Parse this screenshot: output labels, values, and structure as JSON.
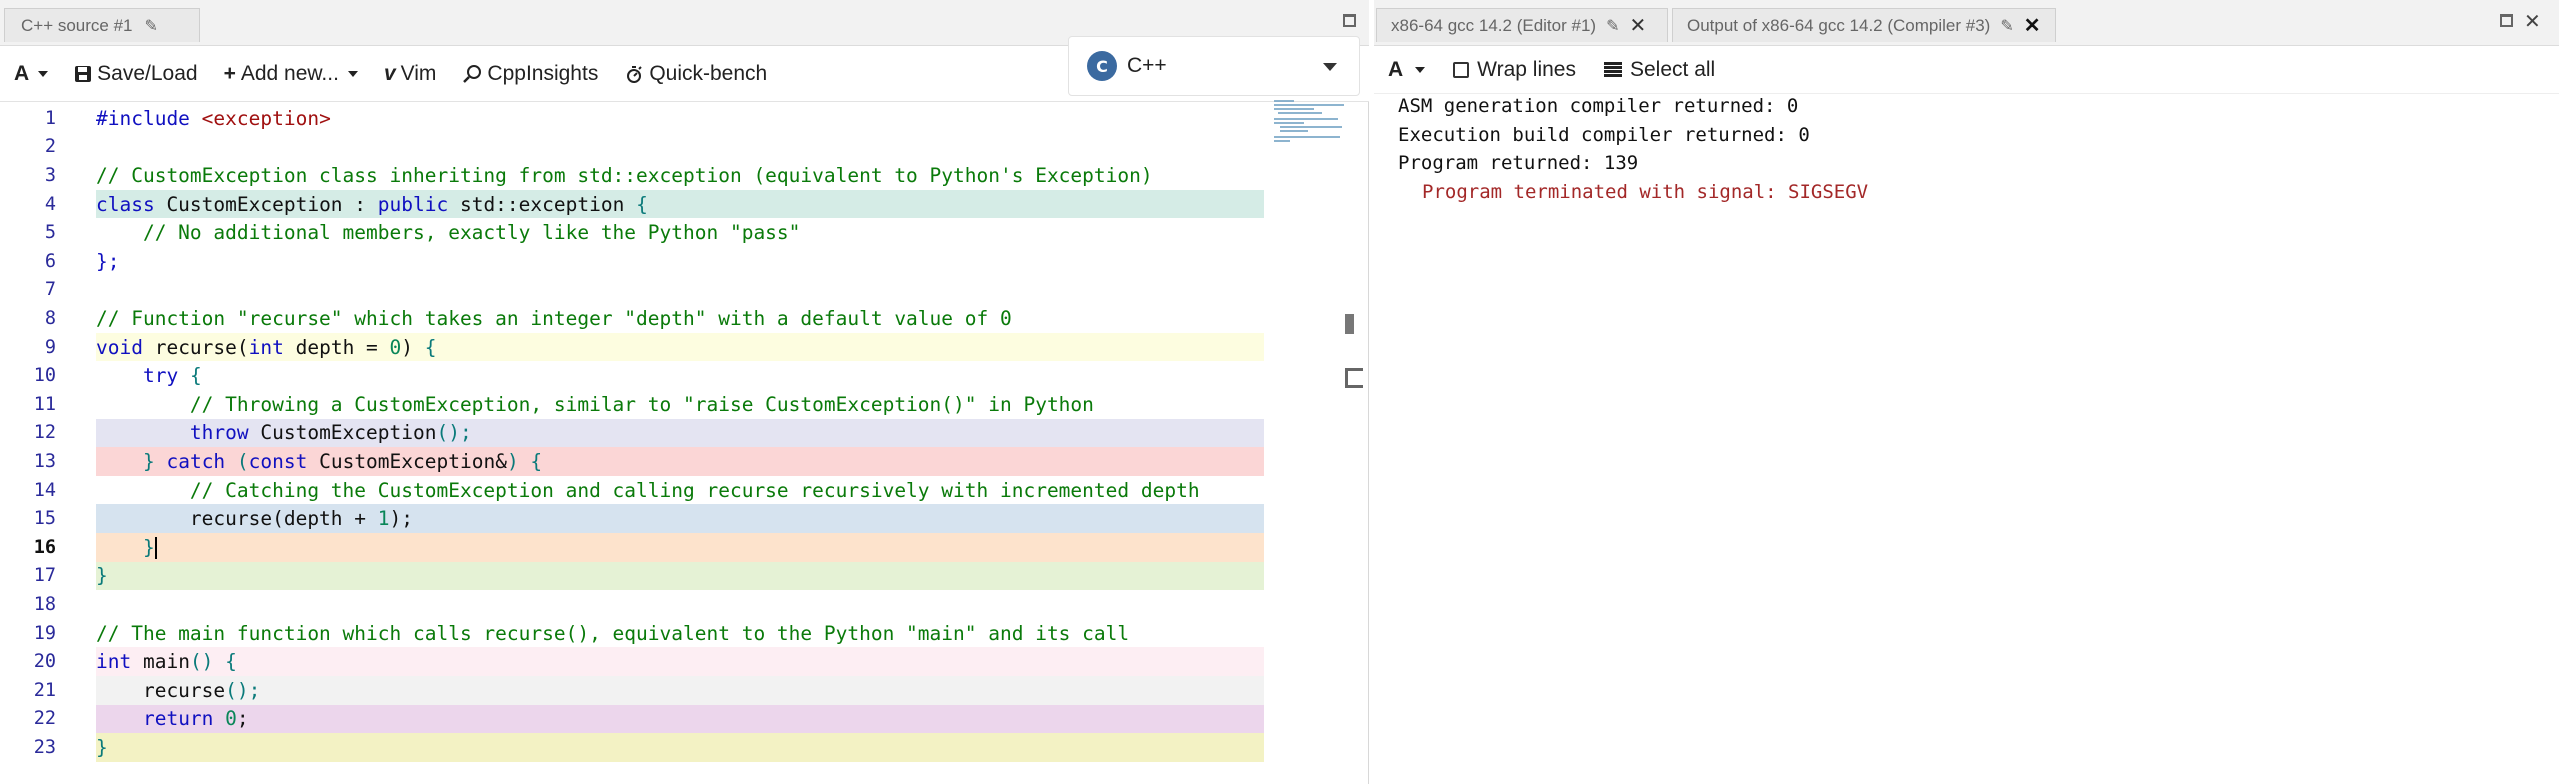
{
  "editor": {
    "tab_title": "C++ source #1",
    "toolbar": {
      "font_button": "A",
      "save_load": "Save/Load",
      "add_new": "Add new...",
      "vim": "Vim",
      "cppinsights": "CppInsights",
      "quick_bench": "Quick-bench"
    },
    "language": "C++",
    "current_line": "16",
    "lines": [
      {
        "n": "1",
        "bg": "",
        "segments": [
          {
            "t": "#include ",
            "c": "kw"
          },
          {
            "t": "<exception>",
            "c": "str"
          }
        ]
      },
      {
        "n": "2",
        "bg": "",
        "segments": []
      },
      {
        "n": "3",
        "bg": "",
        "segments": [
          {
            "t": "// CustomException class inheriting from std::exception (equivalent to Python's Exception)",
            "c": "cmt"
          }
        ]
      },
      {
        "n": "4",
        "bg": "#d5ece6",
        "segments": [
          {
            "t": "class",
            "c": "kw"
          },
          {
            "t": " CustomException : ",
            "c": ""
          },
          {
            "t": "public",
            "c": "kw"
          },
          {
            "t": " std::exception ",
            "c": ""
          },
          {
            "t": "{",
            "c": "brk"
          }
        ]
      },
      {
        "n": "5",
        "bg": "",
        "segments": [
          {
            "t": "    // No additional members, exactly like the Python \"pass\"",
            "c": "cmt"
          }
        ]
      },
      {
        "n": "6",
        "bg": "",
        "segments": [
          {
            "t": "};",
            "c": "kw"
          }
        ]
      },
      {
        "n": "7",
        "bg": "",
        "segments": []
      },
      {
        "n": "8",
        "bg": "",
        "segments": [
          {
            "t": "// Function \"recurse\" which takes an integer \"depth\" with a default value of 0",
            "c": "cmt"
          }
        ]
      },
      {
        "n": "9",
        "bg": "#fdfde0",
        "segments": [
          {
            "t": "void",
            "c": "kw"
          },
          {
            "t": " recurse(",
            "c": ""
          },
          {
            "t": "int",
            "c": "kw"
          },
          {
            "t": " depth = ",
            "c": ""
          },
          {
            "t": "0",
            "c": "num"
          },
          {
            "t": ") ",
            "c": ""
          },
          {
            "t": "{",
            "c": "brk"
          }
        ]
      },
      {
        "n": "10",
        "bg": "",
        "segments": [
          {
            "t": "    ",
            "c": ""
          },
          {
            "t": "try",
            "c": "kw"
          },
          {
            "t": " ",
            "c": ""
          },
          {
            "t": "{",
            "c": "brk"
          }
        ]
      },
      {
        "n": "11",
        "bg": "",
        "segments": [
          {
            "t": "        // Throwing a CustomException, similar to \"raise CustomException()\" in Python",
            "c": "cmt"
          }
        ]
      },
      {
        "n": "12",
        "bg": "#e4e4f2",
        "segments": [
          {
            "t": "        ",
            "c": ""
          },
          {
            "t": "throw",
            "c": "kw"
          },
          {
            "t": " CustomException",
            "c": ""
          },
          {
            "t": "();",
            "c": "brk"
          }
        ]
      },
      {
        "n": "13",
        "bg": "#fbd6d6",
        "segments": [
          {
            "t": "    ",
            "c": ""
          },
          {
            "t": "}",
            "c": "brk"
          },
          {
            "t": " ",
            "c": ""
          },
          {
            "t": "catch",
            "c": "kw"
          },
          {
            "t": " (",
            "c": "brk"
          },
          {
            "t": "const",
            "c": "kw"
          },
          {
            "t": " CustomException&",
            "c": ""
          },
          {
            "t": ") {",
            "c": "brk"
          }
        ]
      },
      {
        "n": "14",
        "bg": "",
        "segments": [
          {
            "t": "        // Catching the CustomException and calling recurse recursively with incremented depth",
            "c": "cmt"
          }
        ]
      },
      {
        "n": "15",
        "bg": "#d6e3ef",
        "segments": [
          {
            "t": "        recurse(depth + ",
            "c": ""
          },
          {
            "t": "1",
            "c": "num"
          },
          {
            "t": ");",
            "c": ""
          }
        ]
      },
      {
        "n": "16",
        "bg": "#fde3cc",
        "segments": [
          {
            "t": "    ",
            "c": ""
          },
          {
            "t": "}",
            "c": "brk"
          }
        ],
        "cursor": true
      },
      {
        "n": "17",
        "bg": "#e5f2d5",
        "segments": [
          {
            "t": "}",
            "c": "brk"
          }
        ]
      },
      {
        "n": "18",
        "bg": "",
        "segments": []
      },
      {
        "n": "19",
        "bg": "",
        "segments": [
          {
            "t": "// The main function which calls recurse(), equivalent to the Python \"main\" and its call",
            "c": "cmt"
          }
        ]
      },
      {
        "n": "20",
        "bg": "#fdeef3",
        "segments": [
          {
            "t": "int",
            "c": "kw"
          },
          {
            "t": " main",
            "c": ""
          },
          {
            "t": "() {",
            "c": "brk"
          }
        ]
      },
      {
        "n": "21",
        "bg": "#f2f2f2",
        "segments": [
          {
            "t": "    recurse",
            "c": ""
          },
          {
            "t": "();",
            "c": "brk"
          }
        ]
      },
      {
        "n": "22",
        "bg": "#ecd6ec",
        "segments": [
          {
            "t": "    ",
            "c": ""
          },
          {
            "t": "return",
            "c": "kw"
          },
          {
            "t": " ",
            "c": ""
          },
          {
            "t": "0",
            "c": "num"
          },
          {
            "t": ";",
            "c": ""
          }
        ]
      },
      {
        "n": "23",
        "bg": "#f3f2c4",
        "segments": [
          {
            "t": "}",
            "c": "brk"
          }
        ]
      }
    ]
  },
  "compiler_pane": {
    "tab_editor": "x86-64 gcc 14.2 (Editor #1)",
    "tab_output": "Output of x86-64 gcc 14.2 (Compiler #3)",
    "toolbar": {
      "font_button": "A",
      "wrap_lines": "Wrap lines",
      "select_all": "Select all"
    },
    "output_lines": [
      "ASM generation compiler returned: 0",
      "Execution build compiler returned: 0",
      "Program returned: 139"
    ],
    "signal_line": "Program terminated with signal: SIGSEGV"
  },
  "colors": {
    "comment": "#0a7a0a",
    "keyword": "#1010c0",
    "string": "#a01010",
    "number": "#098658",
    "signal": "#a32828"
  }
}
